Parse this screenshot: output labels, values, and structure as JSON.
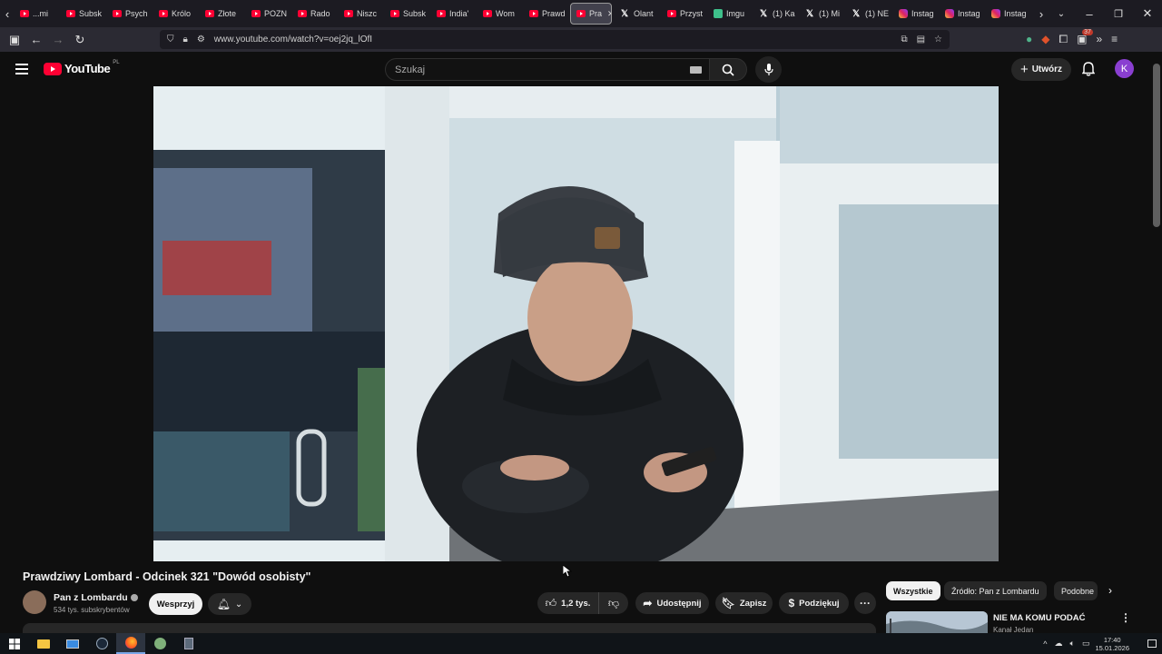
{
  "browser": {
    "tabs": [
      {
        "label": "...mi",
        "icon": "youtube-icon"
      },
      {
        "label": "Subsk",
        "icon": "youtube-icon"
      },
      {
        "label": "Psych",
        "icon": "youtube-icon"
      },
      {
        "label": "Królo",
        "icon": "youtube-icon"
      },
      {
        "label": "Złote",
        "icon": "youtube-icon"
      },
      {
        "label": "POZN",
        "icon": "youtube-icon"
      },
      {
        "label": "Rado",
        "icon": "youtube-icon"
      },
      {
        "label": "Niszc",
        "icon": "youtube-icon"
      },
      {
        "label": "Subsk",
        "icon": "youtube-icon"
      },
      {
        "label": "India'",
        "icon": "youtube-icon"
      },
      {
        "label": "Wom",
        "icon": "youtube-icon"
      },
      {
        "label": "Prawd",
        "icon": "youtube-icon"
      },
      {
        "label": "Pra",
        "icon": "youtube-icon",
        "active": true
      },
      {
        "label": "Olant",
        "icon": "x-icon"
      },
      {
        "label": "Przyst",
        "icon": "youtube-icon"
      },
      {
        "label": "Imgu",
        "icon": "imgur-icon"
      },
      {
        "label": "(1) Ka",
        "icon": "x-icon"
      },
      {
        "label": "(1) Mi",
        "icon": "x-icon"
      },
      {
        "label": "(1) NE",
        "icon": "x-icon"
      },
      {
        "label": "Instag",
        "icon": "instagram-icon"
      },
      {
        "label": "Instag",
        "icon": "instagram-icon"
      },
      {
        "label": "Instag",
        "icon": "instagram-icon"
      }
    ],
    "url": "www.youtube.com/watch?v=oej2jq_lOfI",
    "extensions_badge": "37"
  },
  "youtube": {
    "logo": "YouTube",
    "country": "PL",
    "search_placeholder": "Szukaj",
    "create_label": "Utwórz",
    "avatar_letter": "K"
  },
  "video": {
    "title": "Prawdziwy Lombard - Odcinek 321 \"Dowód osobisty\"",
    "channel": "Pan z Lombardu",
    "subscribers": "534 tys. subskrybentów",
    "support_label": "Wesprzyj",
    "likes": "1,2 tys.",
    "share_label": "Udostępnij",
    "save_label": "Zapisz",
    "thanks_label": "Podziękuj"
  },
  "sidebar": {
    "chips": [
      "Wszystkie",
      "Źródło: Pan z Lombardu",
      "Podobne"
    ],
    "rec_title": "NIE MA KOMU PODAĆ",
    "rec_channel": "Kanał Jedan"
  },
  "taskbar": {
    "time": "17:40",
    "date": "15.01.2026"
  },
  "colors": {
    "yt_red": "#ff0033",
    "background": "#0f0f0f",
    "avatar": "#8a3fd1"
  }
}
